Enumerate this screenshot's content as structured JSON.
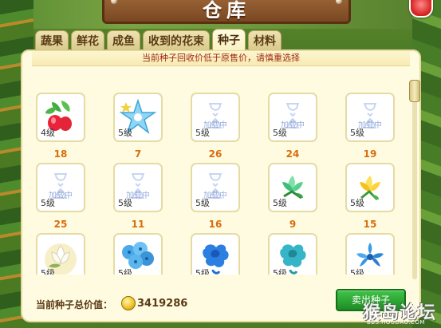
{
  "window": {
    "title": "仓库"
  },
  "tabs": [
    {
      "label": "蔬果",
      "active": false
    },
    {
      "label": "鲜花",
      "active": false
    },
    {
      "label": "成鱼",
      "active": false
    },
    {
      "label": "收到的花束",
      "active": false
    },
    {
      "label": "种子",
      "active": true
    },
    {
      "label": "材料",
      "active": false
    }
  ],
  "notice": "当前种子回收价低于原售价，请慎重选择",
  "items": [
    {
      "level": "4级",
      "qty": "18",
      "icon": "radish-seed-icon",
      "loading": ""
    },
    {
      "level": "5级",
      "qty": "7",
      "icon": "star-flower-icon",
      "loading": ""
    },
    {
      "level": "5级",
      "qty": "26",
      "icon": "hourglass-loading-icon",
      "loading": "加载中"
    },
    {
      "level": "5级",
      "qty": "24",
      "icon": "hourglass-loading-icon",
      "loading": "加载中"
    },
    {
      "level": "5级",
      "qty": "19",
      "icon": "hourglass-loading-icon",
      "loading": "加载中"
    },
    {
      "level": "5级",
      "qty": "25",
      "icon": "hourglass-loading-icon",
      "loading": "加载中"
    },
    {
      "level": "5级",
      "qty": "11",
      "icon": "hourglass-loading-icon",
      "loading": "加载中"
    },
    {
      "level": "5级",
      "qty": "16",
      "icon": "hourglass-loading-icon",
      "loading": "加载中"
    },
    {
      "level": "5级",
      "qty": "9",
      "icon": "green-lily-icon",
      "loading": ""
    },
    {
      "level": "5级",
      "qty": "15",
      "icon": "yellow-lily-icon",
      "loading": ""
    },
    {
      "level": "5级",
      "qty": "",
      "icon": "white-lotus-icon",
      "loading": ""
    },
    {
      "level": "5级",
      "qty": "",
      "icon": "blue-hydrangea-icon",
      "loading": ""
    },
    {
      "level": "5级",
      "qty": "",
      "icon": "blue-rose-icon",
      "loading": ""
    },
    {
      "level": "5级",
      "qty": "",
      "icon": "teal-rose-icon",
      "loading": ""
    },
    {
      "level": "5级",
      "qty": "",
      "icon": "blue-flower-icon",
      "loading": ""
    }
  ],
  "footer": {
    "total_label": "当前种子总价值：",
    "total_value": "3419286",
    "sell_label": "卖出种子"
  },
  "watermark": {
    "main": "猴岛论坛",
    "sub": "BBS.HOUDAO.COM"
  },
  "colors": {
    "qty": "#d96d0b",
    "notice": "#a02a12",
    "sell": "#2aa832"
  }
}
